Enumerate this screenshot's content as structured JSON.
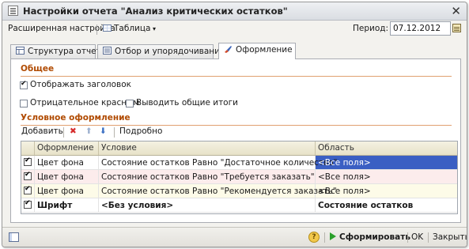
{
  "window": {
    "title": "Настройки отчета \"Анализ критических остатков\""
  },
  "toolbar": {
    "advanced_settings": "Расширенная настройка",
    "table_menu": "Таблица",
    "period_label": "Период:",
    "period_value": "07.12.2012"
  },
  "tabs": [
    {
      "label": "Структура отчета",
      "icon": "structure-icon"
    },
    {
      "label": "Отбор и упорядочивание",
      "icon": "filter-icon"
    },
    {
      "label": "Оформление",
      "icon": "brush-icon",
      "active": true
    }
  ],
  "general": {
    "title": "Общее",
    "show_header": {
      "label": "Отображать заголовок",
      "checked": true
    },
    "negative_red": {
      "label": "Отрицательное красным",
      "checked": false
    },
    "show_totals": {
      "label": "Выводить общие итоги",
      "checked": false
    }
  },
  "conditional": {
    "title": "Условное оформление",
    "add_label": "Добавить",
    "details_label": "Подробно",
    "columns": {
      "format": "Оформление",
      "condition": "Условие",
      "area": "Область"
    },
    "rows": [
      {
        "checked": true,
        "format": "Цвет фона",
        "condition": "Состояние остатков Равно \"Достаточное количество\"",
        "area": "<Все поля>",
        "bg": "#ffffff",
        "selected": true
      },
      {
        "checked": true,
        "format": "Цвет фона",
        "condition": "Состояние остатков Равно \"Требуется заказать\"",
        "area": "<Все поля>",
        "bg": "#fcecec"
      },
      {
        "checked": true,
        "format": "Цвет фона",
        "condition": "Состояние остатков Равно \"Рекомендуется заказать\"",
        "area": "<Все поля>",
        "bg": "#fdfbe8"
      },
      {
        "checked": true,
        "format": "Шрифт",
        "condition": "<Без условия>",
        "area": "Состояние остатков",
        "bg": "#ffffff",
        "bold": true
      }
    ]
  },
  "statusbar": {
    "help": "?",
    "generate": "Сформировать",
    "ok": "OK",
    "close": "Закрыть"
  },
  "colors": {
    "section_title": "#b04a00",
    "selection": "#3a5fc3",
    "accent_green": "#2aa02a"
  }
}
